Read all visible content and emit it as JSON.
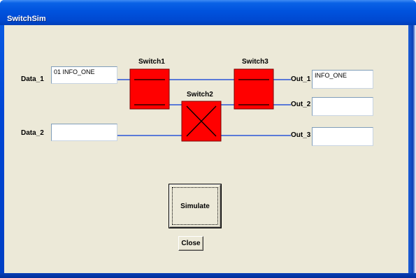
{
  "window": {
    "title": "SwitchSim"
  },
  "inputs": {
    "data_1": {
      "label": "Data_1",
      "value": "01 INFO_ONE"
    },
    "data_2": {
      "label": "Data_2",
      "value": ""
    }
  },
  "switches": {
    "switch1": {
      "label": "Switch1",
      "state": "straight"
    },
    "switch2": {
      "label": "Switch2",
      "state": "crossed"
    },
    "switch3": {
      "label": "Switch3",
      "state": "straight"
    }
  },
  "outputs": {
    "out_1": {
      "label": "Out_1",
      "value": "INFO_ONE"
    },
    "out_2": {
      "label": "Out_2",
      "value": ""
    },
    "out_3": {
      "label": "Out_3",
      "value": ""
    }
  },
  "buttons": {
    "simulate": "Simulate",
    "close": "Close"
  },
  "colors": {
    "switch_fill": "#ff0000",
    "switch_border": "#800000",
    "wire": "#2a56d8",
    "window_face": "#ece9d8",
    "title_blue": "#0052dd"
  }
}
